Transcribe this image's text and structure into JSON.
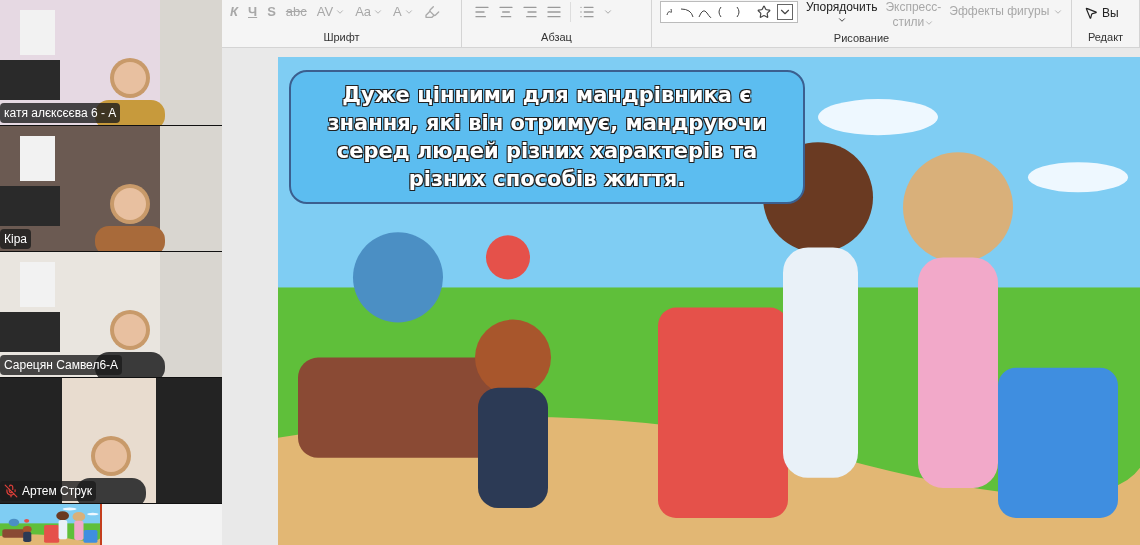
{
  "participants": [
    {
      "name": "катя алєксєєва 6 - А",
      "muted": false,
      "kind": "full"
    },
    {
      "name": "Кіра",
      "muted": false,
      "kind": "full"
    },
    {
      "name": "Сарецян Самвел6-А",
      "muted": false,
      "kind": "full"
    },
    {
      "name": "Артем Струк",
      "muted": true,
      "kind": "pillar"
    }
  ],
  "ribbon": {
    "groups": [
      {
        "label": "Шрифт",
        "kind": "font",
        "buttons": [
          {
            "text": "К",
            "disabled": true
          },
          {
            "text": "Ч",
            "disabled": true
          },
          {
            "text": "S",
            "disabled": true
          },
          {
            "text": "abc",
            "disabled": true
          },
          {
            "text": "AV",
            "disabled": true,
            "dropdown": true
          },
          {
            "text": "Aa",
            "disabled": true,
            "dropdown": true
          },
          {
            "text": "A",
            "disabled": true,
            "dropdown": true
          }
        ]
      },
      {
        "label": "Абзац",
        "kind": "paragraph"
      },
      {
        "label": "Рисование",
        "kind": "drawing",
        "buttons": [
          {
            "text": "Упорядочить",
            "disabled": false,
            "dropdown": true
          },
          {
            "text": "Экспресс-",
            "text2": "стили",
            "disabled": true,
            "dropdown": true
          },
          {
            "text": "Эффекты фигуры",
            "disabled": true,
            "dropdown": true
          }
        ]
      },
      {
        "label": "Редакт",
        "kind": "editing",
        "buttons": [
          {
            "text": "Вы",
            "disabled": false
          }
        ]
      }
    ]
  },
  "slide": {
    "text_lines": [
      "Дуже цінними для мандрівника є",
      "знання, які він отримує, мандруючи",
      "серед людей різних характерів та",
      "різних способів життя."
    ]
  },
  "thumbnails": [
    {
      "kind": "picture",
      "selected": true
    }
  ]
}
